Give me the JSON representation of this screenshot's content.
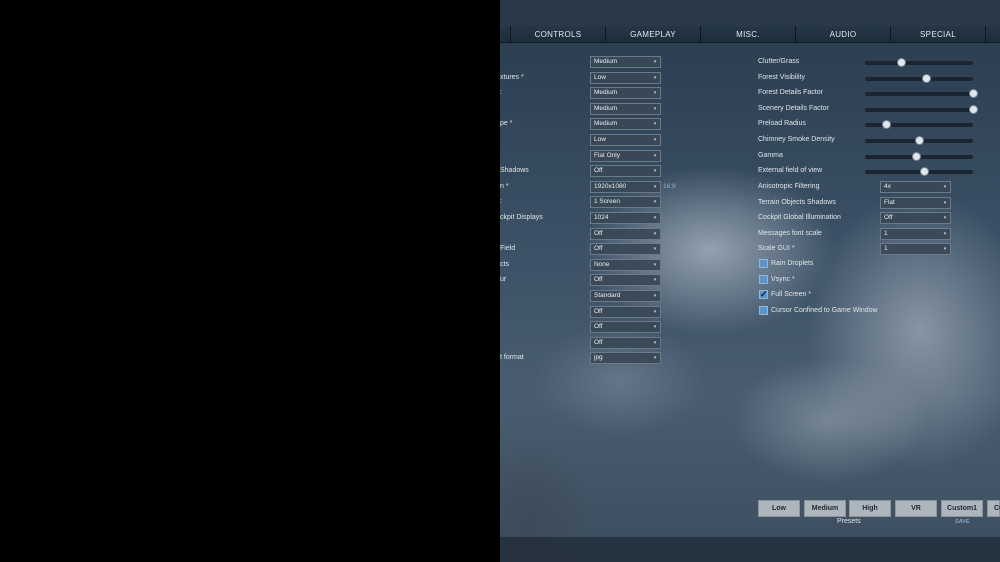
{
  "tabs": [
    "CONTROLS",
    "GAMEPLAY",
    "MISC.",
    "AUDIO",
    "SPECIAL"
  ],
  "left_rows": [
    {
      "label": "",
      "value": "Medium"
    },
    {
      "label": "xtures *",
      "value": "Low"
    },
    {
      "label": ":",
      "value": "Medium"
    },
    {
      "label": "",
      "value": "Medium"
    },
    {
      "label": "pe *",
      "value": "Medium"
    },
    {
      "label": "",
      "value": "Low"
    },
    {
      "label": "",
      "value": "Flat Only"
    },
    {
      "label": "Shadows",
      "value": "Off"
    },
    {
      "label": "n *",
      "value": "1920x1080"
    },
    {
      "label": ":",
      "value": "1 Screen"
    },
    {
      "label": "ckpit Displays",
      "value": "1024"
    },
    {
      "label": "",
      "value": "Off"
    },
    {
      "label": "Field",
      "value": "Off"
    },
    {
      "label": "cts",
      "value": "None"
    },
    {
      "label": "ur",
      "value": "Off"
    },
    {
      "label": "",
      "value": "Standard"
    },
    {
      "label": "",
      "value": "Off"
    },
    {
      "label": "",
      "value": "Off"
    },
    {
      "label": "",
      "value": "Off"
    },
    {
      "label": "t format",
      "value": "jpg"
    }
  ],
  "aspect_ratio": "16:9",
  "sliders": [
    {
      "label": "Clutter/Grass",
      "value": 0.34
    },
    {
      "label": "Forest Visibility",
      "value": 0.57
    },
    {
      "label": "Forest Details Factor",
      "value": 1.0
    },
    {
      "label": "Scenery Details Factor",
      "value": 1.0
    },
    {
      "label": "Preload Radius",
      "value": 0.2
    },
    {
      "label": "Chimney Smoke Density",
      "value": 0.5
    },
    {
      "label": "Gamma",
      "value": 0.48
    },
    {
      "label": "External field of view",
      "value": 0.55
    }
  ],
  "right_selects": [
    {
      "label": "Anisotropic Filtering",
      "value": "4x"
    },
    {
      "label": "Terrain Objects Shadows",
      "value": "Flat"
    },
    {
      "label": "Cockpit Global Illumination",
      "value": "Off"
    },
    {
      "label": "Messages font scale",
      "value": "1"
    },
    {
      "label": "Scale GUI *",
      "value": "1"
    }
  ],
  "checkboxes": [
    {
      "label": "Rain Droplets",
      "checked": false
    },
    {
      "label": "Vsync *",
      "checked": false
    },
    {
      "label": "Full Screen *",
      "checked": true
    },
    {
      "label": "Cursor Confined to Game Window",
      "checked": false
    }
  ],
  "presets": {
    "buttons": [
      "Low",
      "Medium",
      "High",
      "VR",
      "Custom1",
      "Cu"
    ],
    "label": "Presets",
    "save": "SAVE"
  },
  "colors": {
    "accent": "#5c93c8",
    "button_bg": "#aeb6bd"
  }
}
